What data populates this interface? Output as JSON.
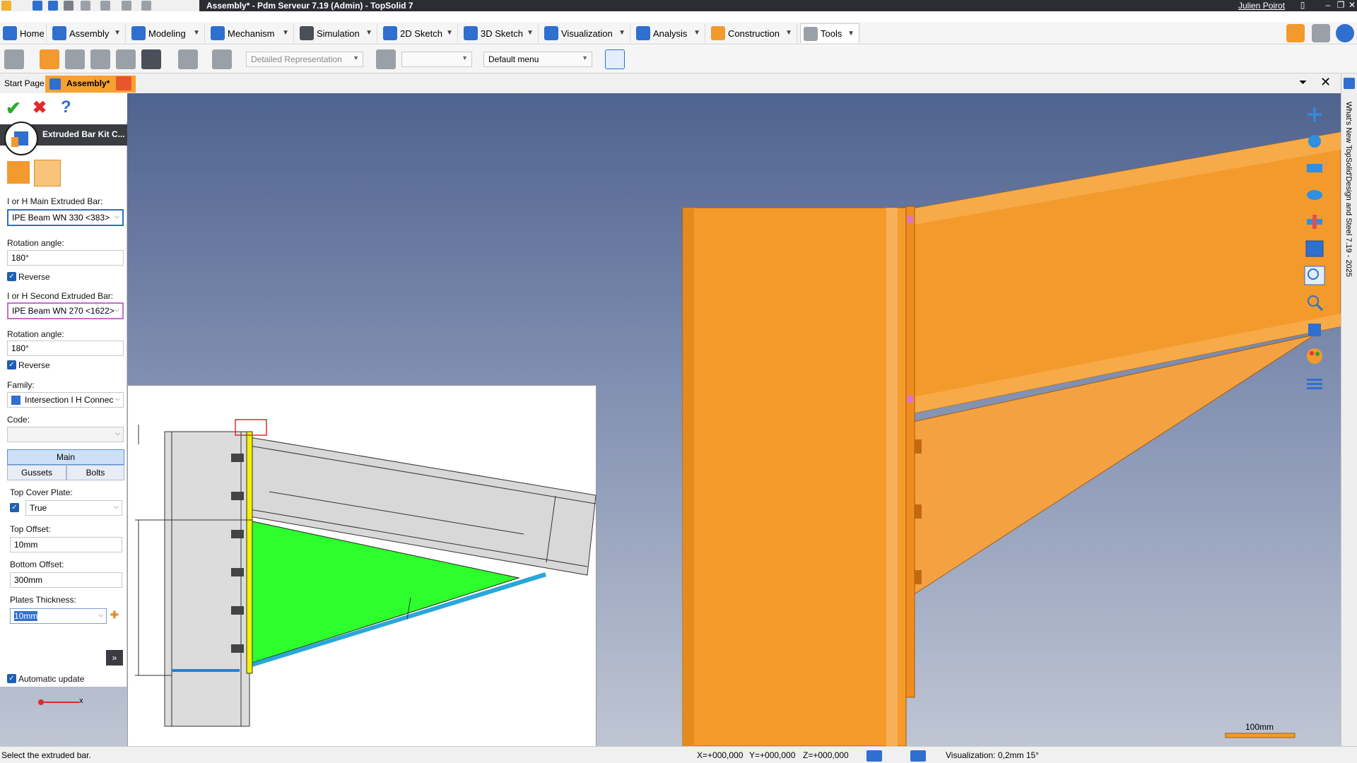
{
  "window": {
    "title": "Assembly* - Pdm Serveur 7.19 (Admin) - TopSolid 7",
    "user": "Julien Poirot"
  },
  "ribbon": {
    "tabs": [
      {
        "label": "Home",
        "icon": "home-icon"
      },
      {
        "label": "Assembly",
        "icon": "assembly-icon"
      },
      {
        "label": "Modeling",
        "icon": "modeling-icon"
      },
      {
        "label": "Mechanism",
        "icon": "mechanism-icon"
      },
      {
        "label": "Simulation",
        "icon": "simulation-icon"
      },
      {
        "label": "2D Sketch",
        "icon": "sketch-2d-icon"
      },
      {
        "label": "3D Sketch",
        "icon": "sketch-3d-icon"
      },
      {
        "label": "Visualization",
        "icon": "visualization-icon"
      },
      {
        "label": "Analysis",
        "icon": "analysis-icon"
      },
      {
        "label": "Construction",
        "icon": "construction-icon"
      },
      {
        "label": "Tools",
        "icon": "tools-icon"
      }
    ]
  },
  "toolbar": {
    "representation": "Detailed Representation",
    "secondary_select": "",
    "menu_select": "Default menu"
  },
  "doctabs": {
    "start_page": "Start Page",
    "assembly": "Assembly*"
  },
  "sidebar": {
    "whats_new": "What's New TopSolid'Design and Steel 7.19 - 2025"
  },
  "panel": {
    "title": "Extruded Bar Kit C...",
    "main_bar_label": "I or H Main Extruded Bar:",
    "main_bar_value": "IPE Beam WN 330 <383>",
    "rotation1_label": "Rotation angle:",
    "rotation1_value": "180°",
    "reverse1_label": "Reverse",
    "second_bar_label": "I or H Second Extruded Bar:",
    "second_bar_value": "IPE Beam WN 270 <1622>",
    "rotation2_label": "Rotation angle:",
    "rotation2_value": "180°",
    "reverse2_label": "Reverse",
    "family_label": "Family:",
    "family_value": "Intersection I H Connec",
    "code_label": "Code:",
    "code_value": "",
    "tab_main": "Main",
    "tab_gussets": "Gussets",
    "tab_bolts": "Bolts",
    "top_cover_label": "Top Cover Plate:",
    "top_cover_value": "True",
    "top_offset_label": "Top Offset:",
    "top_offset_value": "10mm",
    "bottom_offset_label": "Bottom Offset:",
    "bottom_offset_value": "300mm",
    "thickness_label": "Plates Thickness:",
    "thickness_value": "10mm",
    "auto_update_label": "Automatic update",
    "expand_label": "»"
  },
  "viewport": {
    "scale_label": "100mm",
    "axis_x": "x"
  },
  "status": {
    "message": "Select the extruded bar.",
    "x": "X=+000,000",
    "y": "Y=+000,000",
    "z": "Z=+000,000",
    "visualization": "Visualization: 0,2mm 15°"
  },
  "colors": {
    "accent": "#f7a131",
    "beam": "#f59b2c",
    "gusset_preview": "#2cff2c",
    "plate_preview": "#f2f200"
  }
}
